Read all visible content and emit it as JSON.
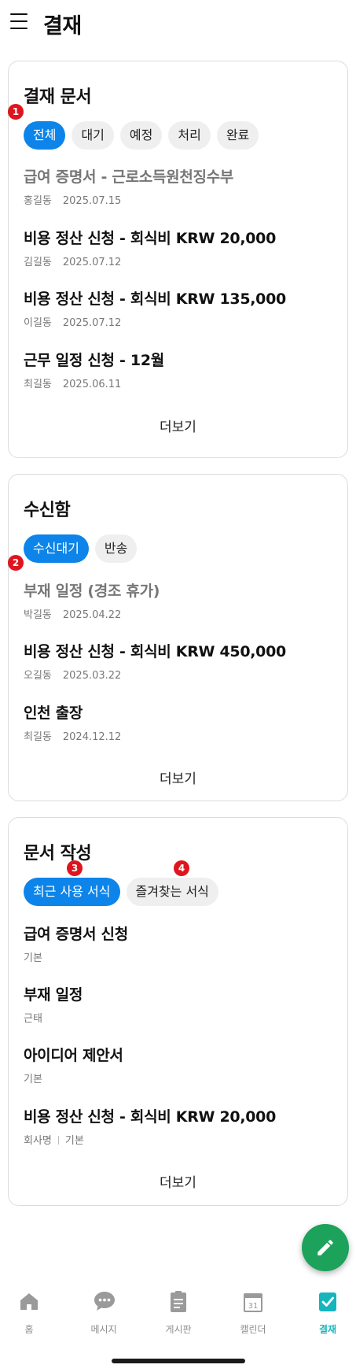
{
  "header": {
    "title": "결재"
  },
  "approval": {
    "title": "결재 문서",
    "chips": [
      "전체",
      "대기",
      "예정",
      "처리",
      "완료"
    ],
    "docs": [
      {
        "title": "급여 증명서 - 근로소득원천징수부",
        "author": "홍길동",
        "date": "2025.07.15"
      },
      {
        "title": "비용 정산 신청 - 회식비 KRW 20,000",
        "author": "김길동",
        "date": "2025.07.12"
      },
      {
        "title": "비용 정산 신청 - 회식비 KRW 135,000",
        "author": "이길동",
        "date": "2025.07.12"
      },
      {
        "title": "근무 일정 신청 - 12월",
        "author": "최길동",
        "date": "2025.06.11"
      }
    ],
    "more": "더보기"
  },
  "inbox": {
    "title": "수신함",
    "chips": [
      "수신대기",
      "반송"
    ],
    "docs": [
      {
        "title": "부재 일정 (경조 휴가)",
        "author": "박길동",
        "date": "2025.04.22"
      },
      {
        "title": "비용 정산 신청 - 회식비 KRW 450,000",
        "author": "오길동",
        "date": "2025.03.22"
      },
      {
        "title": "인천 출장",
        "author": "최길동",
        "date": "2024.12.12"
      }
    ],
    "more": "더보기"
  },
  "compose": {
    "title": "문서 작성",
    "chips": [
      "최근 사용 서식",
      "즐겨찾는 서식"
    ],
    "forms": [
      {
        "title": "급여 증명서 신청",
        "category": "기본"
      },
      {
        "title": "부재 일정",
        "category": "근태"
      },
      {
        "title": "아이디어 제안서",
        "category": "기본"
      },
      {
        "title": "비용 정산 신청 - 회식비 KRW 20,000",
        "company": "회사명",
        "category": "기본"
      }
    ],
    "more": "더보기"
  },
  "badges": [
    "1",
    "2",
    "3",
    "4"
  ],
  "tabs": [
    {
      "label": "홈",
      "icon": "home-icon"
    },
    {
      "label": "메시지",
      "icon": "chat-icon"
    },
    {
      "label": "게시판",
      "icon": "board-icon"
    },
    {
      "label": "캘린더",
      "icon": "calendar-icon",
      "day": "31"
    },
    {
      "label": "결재",
      "icon": "approval-icon",
      "active": true
    }
  ],
  "colors": {
    "accent": "#0d84e9",
    "fab": "#1ca25b",
    "active_tab": "#15b5be",
    "badge": "#e0141e"
  }
}
